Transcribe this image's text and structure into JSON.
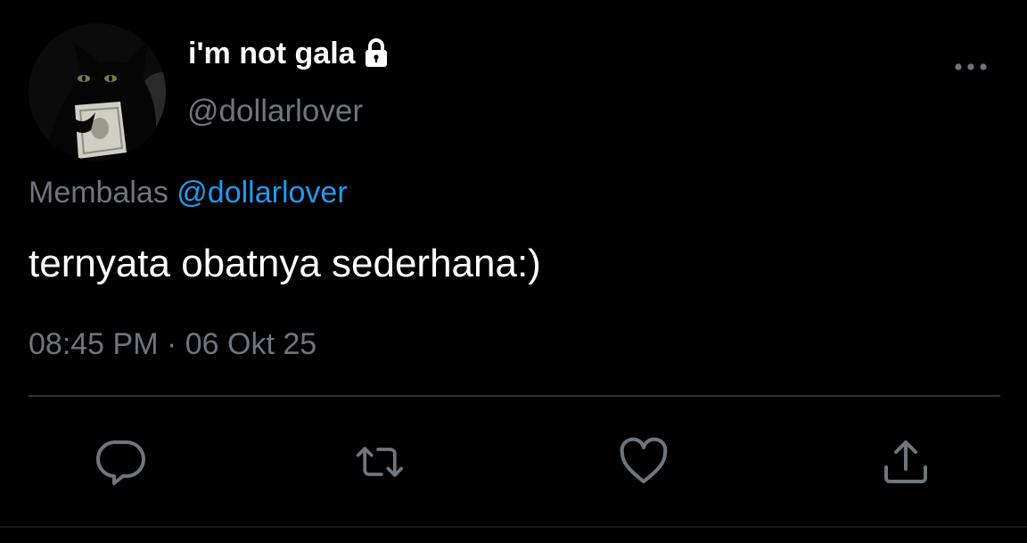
{
  "user": {
    "display_name": "i'm not gala",
    "handle": "@dollarlover",
    "avatar_icon": "black-cat-with-dollar-avatar",
    "protected_icon": "lock-icon"
  },
  "header": {
    "more_icon": "more-horizontal-icon"
  },
  "reply": {
    "prefix": "Membalas",
    "mention": "@dollarlover"
  },
  "tweet": {
    "text": "ternyata obatnya sederhana:)",
    "time": "08:45 PM",
    "separator": "·",
    "date": "06 Okt 25"
  },
  "actions": {
    "reply_icon": "reply-icon",
    "retweet_icon": "retweet-icon",
    "like_icon": "like-heart-icon",
    "share_icon": "share-icon"
  },
  "colors": {
    "background": "#000000",
    "primary_text": "#ffffff",
    "secondary_text": "#6e767d",
    "link": "#1d9bf0",
    "divider": "#2f3336",
    "icon": "#6e767d"
  }
}
